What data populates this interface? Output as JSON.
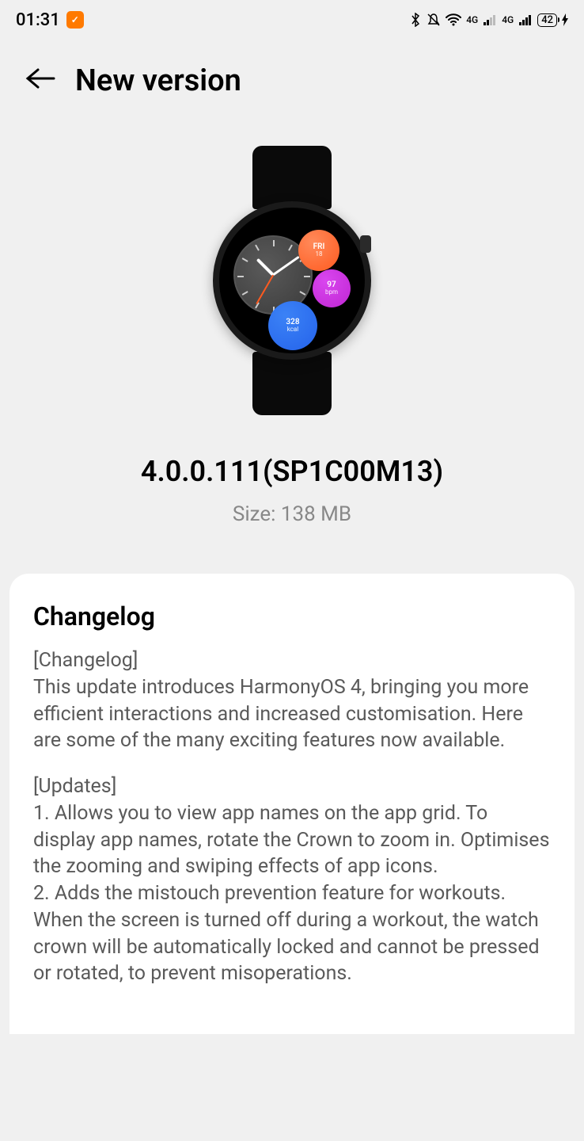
{
  "status_bar": {
    "time": "01:31",
    "battery": "42",
    "signal1": "4G",
    "signal2": "4G"
  },
  "header": {
    "title": "New version"
  },
  "watch_face": {
    "date_day": "FRI",
    "date_num": "18",
    "hr_value": "97",
    "hr_unit": "bpm",
    "kcal_value": "328",
    "kcal_unit": "kcal"
  },
  "version": {
    "number": "4.0.0.111(SP1C00M13)",
    "size": "Size: 138 MB"
  },
  "changelog": {
    "title": "Changelog",
    "section1_header": "[Changelog]",
    "section1_body": "This update introduces HarmonyOS 4, bringing you more efficient interactions and increased customisation. Here are some of the many exciting features now available.",
    "section2_header": "[Updates]",
    "section2_item1": "1. Allows you to view app names on the app grid. To display app names, rotate the Crown to zoom in. Optimises the zooming and swiping effects of app icons.",
    "section2_item2": "2. Adds the mistouch prevention feature for workouts. When the screen is turned off during a workout, the watch crown will be automatically locked and cannot be pressed or rotated, to prevent misoperations."
  }
}
